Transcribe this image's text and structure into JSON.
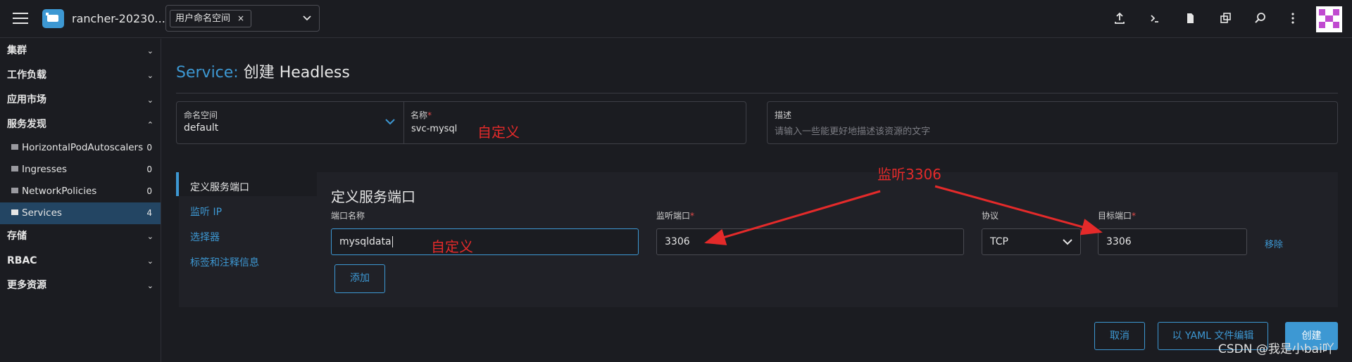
{
  "header": {
    "cluster_name": "rancher-20230...",
    "namespace_chip": "用户命名空间",
    "chip_close": "×"
  },
  "sidebar": {
    "groups": [
      {
        "label": "集群",
        "chevron": "⌄"
      },
      {
        "label": "工作负载",
        "chevron": "⌄"
      },
      {
        "label": "应用市场",
        "chevron": "⌄"
      },
      {
        "label": "服务发现",
        "chevron": "⌃"
      }
    ],
    "items": [
      {
        "label": "HorizontalPodAutoscalers",
        "count": "0"
      },
      {
        "label": "Ingresses",
        "count": "0"
      },
      {
        "label": "NetworkPolicies",
        "count": "0"
      },
      {
        "label": "Services",
        "count": "4"
      }
    ],
    "groups_after": [
      {
        "label": "存储",
        "chevron": "⌄"
      },
      {
        "label": "RBAC",
        "chevron": "⌄"
      },
      {
        "label": "更多资源",
        "chevron": "⌄"
      }
    ]
  },
  "page": {
    "title_prefix": "Service:",
    "title_rest": "创建 Headless"
  },
  "form": {
    "namespace_label": "命名空间",
    "namespace_value": "default",
    "name_label": "名称",
    "name_value": "svc-mysql",
    "required_mark": "*",
    "description_label": "描述",
    "description_placeholder": "请输入一些能更好地描述该资源的文字"
  },
  "tabs": [
    {
      "label": "定义服务端口"
    },
    {
      "label": "监听 IP"
    },
    {
      "label": "选择器"
    },
    {
      "label": "标签和注释信息"
    }
  ],
  "ports": {
    "section_title": "定义服务端口",
    "col_port_name": "端口名称",
    "col_listen_port": "监听端口",
    "col_protocol": "协议",
    "col_target_port": "目标端口",
    "row": {
      "port_name": "mysqldata",
      "listen_port": "3306",
      "protocol": "TCP",
      "target_port": "3306",
      "remove_label": "移除"
    },
    "add_label": "添加"
  },
  "footer": {
    "cancel_label": "取消",
    "yaml_label": "以 YAML 文件编辑",
    "create_label": "创建"
  },
  "annotations": {
    "custom_name": "自定义",
    "custom_port_name": "自定义",
    "listen_note": "监听3306"
  },
  "watermark": "CSDN @我是小bai吖",
  "colors": {
    "accent": "#3d98d3",
    "annotation": "#e42a2a",
    "active_nav": "#234563"
  }
}
